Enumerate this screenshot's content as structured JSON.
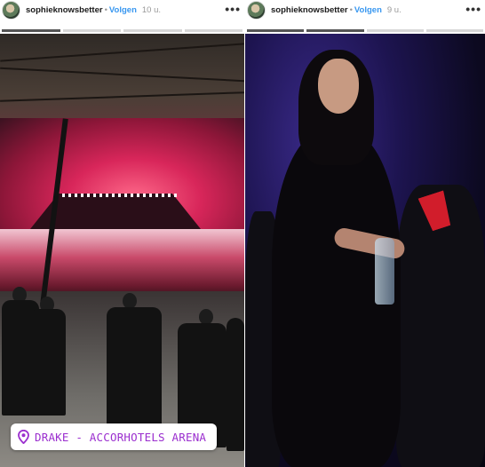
{
  "stories": [
    {
      "header": {
        "username": "sophieknowsbetter",
        "separator": "•",
        "follow_label": "Volgen",
        "time": "10 u.",
        "more_icon": "more-horizontal-icon"
      },
      "progress": {
        "segments": 4,
        "completed": 1
      },
      "location": {
        "icon": "location-pin-icon",
        "text": "DRAKE - ACCORHOTELS ARENA",
        "color": "#9b2fcf"
      }
    },
    {
      "header": {
        "username": "sophieknowsbetter",
        "separator": "•",
        "follow_label": "Volgen",
        "time": "9 u.",
        "more_icon": "more-horizontal-icon"
      },
      "progress": {
        "segments": 4,
        "completed": 2
      }
    }
  ],
  "colors": {
    "follow_accent": "#3897f0",
    "progress_done": "#555555",
    "progress_todo": "#d7d7d7"
  }
}
